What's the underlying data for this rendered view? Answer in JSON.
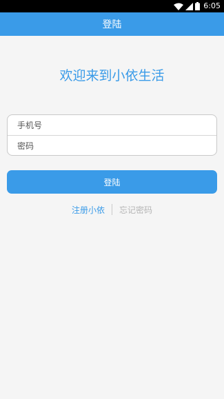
{
  "status_bar": {
    "time": "6:05",
    "icons": [
      "wifi-icon",
      "signal-icon",
      "battery-icon"
    ]
  },
  "header": {
    "title": "登陆"
  },
  "main": {
    "welcome": "欢迎来到小依生活",
    "phone_placeholder": "手机号",
    "password_placeholder": "密码",
    "login_label": "登陆",
    "register_link": "注册小依",
    "forgot_link": "忘记密码"
  },
  "colors": {
    "accent": "#3a9be8",
    "background": "#f5f5f5",
    "muted_link": "#b5b5b5"
  }
}
